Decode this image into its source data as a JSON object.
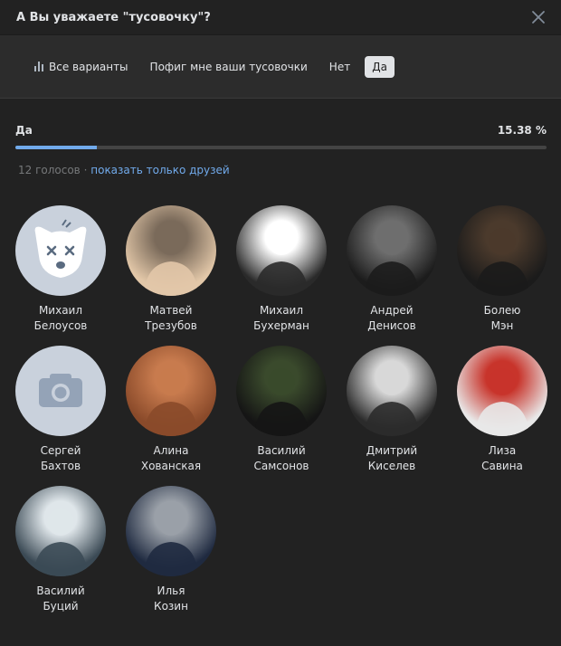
{
  "header": {
    "title": "А Вы уважаете \"тусовочку\"?"
  },
  "tabs": [
    {
      "label": "Все варианты",
      "icon": "stats-bars-icon",
      "active": false
    },
    {
      "label": "Пофиг мне ваши тусовочки",
      "active": false
    },
    {
      "label": "Нет",
      "active": false
    },
    {
      "label": "Да",
      "active": true
    }
  ],
  "result": {
    "label": "Да",
    "percent_text": "15.38 %",
    "percent": 15.38
  },
  "meta": {
    "votes": "12 голосов",
    "separator": "·",
    "friends_link": "показать только друзей"
  },
  "voters": [
    {
      "first": "Михаил",
      "last": "Белоусов",
      "avatar": "default-dog-avatar",
      "colors": [
        "#c9d1dc",
        "#ffffff"
      ]
    },
    {
      "first": "Матвей",
      "last": "Трезубов",
      "avatar": "photo",
      "colors": [
        "#7a6a5a",
        "#e2c7a8"
      ]
    },
    {
      "first": "Михаил",
      "last": "Бухерман",
      "avatar": "photo",
      "colors": [
        "#ffffff",
        "#2a2a2a"
      ]
    },
    {
      "first": "Андрей",
      "last": "Денисов",
      "avatar": "photo",
      "colors": [
        "#6e6e6e",
        "#1c1c1c"
      ]
    },
    {
      "first": "Болею",
      "last": "Мэн",
      "avatar": "photo",
      "colors": [
        "#4b3a2c",
        "#1b1b1b"
      ]
    },
    {
      "first": "Сергей",
      "last": "Бахтов",
      "avatar": "default-camera-avatar",
      "colors": [
        "#c9d1dc",
        "#94a3b7"
      ]
    },
    {
      "first": "Алина",
      "last": "Хованская",
      "avatar": "photo",
      "colors": [
        "#c87b4e",
        "#8a4a2a"
      ]
    },
    {
      "first": "Василий",
      "last": "Самсонов",
      "avatar": "photo",
      "colors": [
        "#3a4a2c",
        "#151515"
      ]
    },
    {
      "first": "Дмитрий",
      "last": "Киселев",
      "avatar": "photo",
      "colors": [
        "#d8d8d8",
        "#2b2b2b"
      ]
    },
    {
      "first": "Лиза",
      "last": "Савина",
      "avatar": "photo",
      "colors": [
        "#c8342b",
        "#e8e8e8"
      ]
    },
    {
      "first": "Василий",
      "last": "Буций",
      "avatar": "photo",
      "colors": [
        "#dfe6ea",
        "#3b4a55"
      ]
    },
    {
      "first": "Илья",
      "last": "Козин",
      "avatar": "photo",
      "colors": [
        "#9aa0a8",
        "#1f2a40"
      ]
    }
  ]
}
